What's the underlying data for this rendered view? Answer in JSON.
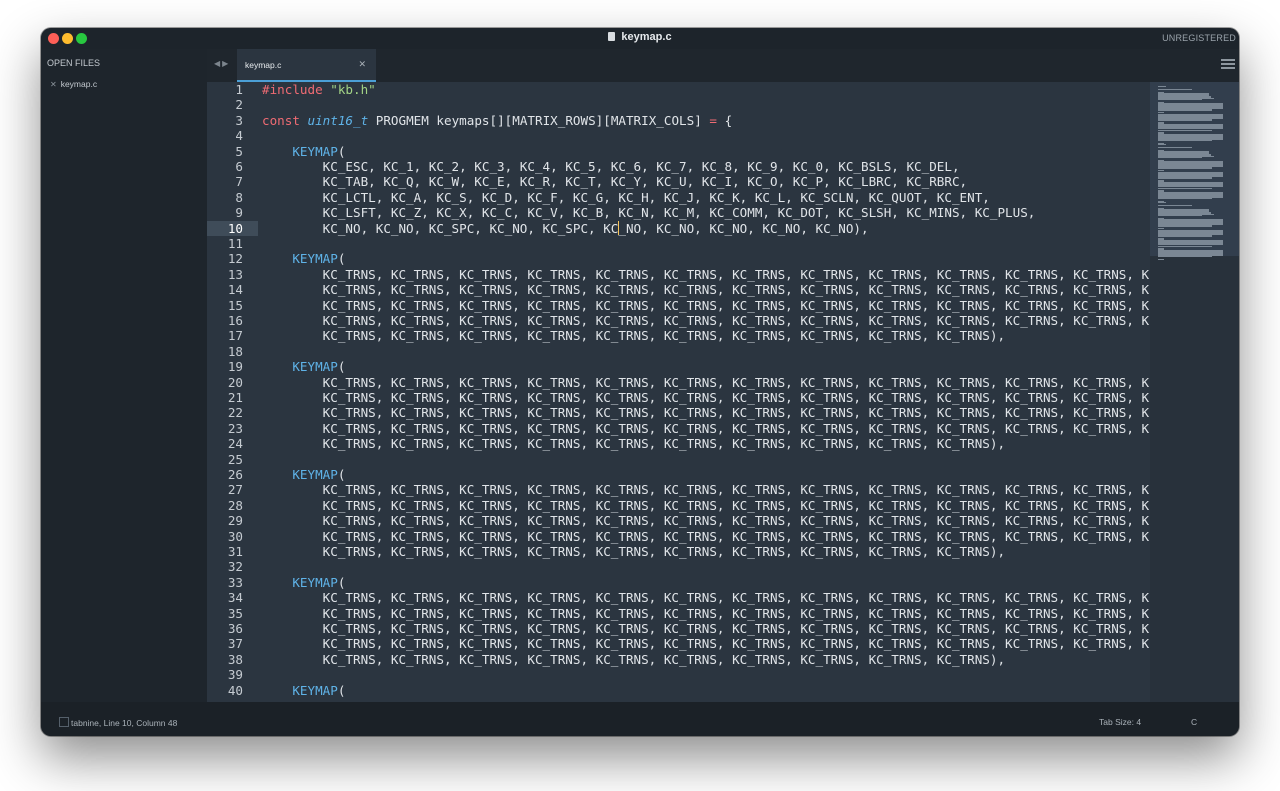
{
  "window": {
    "title": "keymap.c",
    "badge": "UNREGISTERED"
  },
  "sidebar": {
    "header": "OPEN FILES",
    "files": [
      {
        "name": "keymap.c",
        "close": "✕"
      }
    ]
  },
  "tabs": [
    {
      "label": "keymap.c",
      "close": "✕",
      "active": true
    }
  ],
  "nav": {
    "back": "◀",
    "forward": "▶"
  },
  "editor": {
    "current_line": 10,
    "lines": [
      {
        "n": "1",
        "text": "#include \"kb.h\""
      },
      {
        "n": "2",
        "text": ""
      },
      {
        "n": "3",
        "text": "const uint16_t PROGMEM keymaps[][MATRIX_ROWS][MATRIX_COLS] = {"
      },
      {
        "n": "4",
        "text": ""
      },
      {
        "n": "5",
        "text": "    KEYMAP("
      },
      {
        "n": "6",
        "text": "        KC_ESC, KC_1, KC_2, KC_3, KC_4, KC_5, KC_6, KC_7, KC_8, KC_9, KC_0, KC_BSLS, KC_DEL,"
      },
      {
        "n": "7",
        "text": "        KC_TAB, KC_Q, KC_W, KC_E, KC_R, KC_T, KC_Y, KC_U, KC_I, KC_O, KC_P, KC_LBRC, KC_RBRC,"
      },
      {
        "n": "8",
        "text": "        KC_LCTL, KC_A, KC_S, KC_D, KC_F, KC_G, KC_H, KC_J, KC_K, KC_L, KC_SCLN, KC_QUOT, KC_ENT,"
      },
      {
        "n": "9",
        "text": "        KC_LSFT, KC_Z, KC_X, KC_C, KC_V, KC_B, KC_N, KC_M, KC_COMM, KC_DOT, KC_SLSH, KC_MINS, KC_PLUS,"
      },
      {
        "n": "10",
        "text": "        KC_NO, KC_NO, KC_SPC, KC_NO, KC_SPC, KC_NO, KC_NO, KC_NO, KC_NO, KC_NO),"
      },
      {
        "n": "11",
        "text": ""
      },
      {
        "n": "12",
        "text": "    KEYMAP("
      },
      {
        "n": "13",
        "text": "        KC_TRNS, KC_TRNS, KC_TRNS, KC_TRNS, KC_TRNS, KC_TRNS, KC_TRNS, KC_TRNS, KC_TRNS, KC_TRNS, KC_TRNS, KC_TRNS, KC_"
      },
      {
        "n": "14",
        "text": "        KC_TRNS, KC_TRNS, KC_TRNS, KC_TRNS, KC_TRNS, KC_TRNS, KC_TRNS, KC_TRNS, KC_TRNS, KC_TRNS, KC_TRNS, KC_TRNS, KC_"
      },
      {
        "n": "15",
        "text": "        KC_TRNS, KC_TRNS, KC_TRNS, KC_TRNS, KC_TRNS, KC_TRNS, KC_TRNS, KC_TRNS, KC_TRNS, KC_TRNS, KC_TRNS, KC_TRNS, KC_"
      },
      {
        "n": "16",
        "text": "        KC_TRNS, KC_TRNS, KC_TRNS, KC_TRNS, KC_TRNS, KC_TRNS, KC_TRNS, KC_TRNS, KC_TRNS, KC_TRNS, KC_TRNS, KC_TRNS, KC_"
      },
      {
        "n": "17",
        "text": "        KC_TRNS, KC_TRNS, KC_TRNS, KC_TRNS, KC_TRNS, KC_TRNS, KC_TRNS, KC_TRNS, KC_TRNS, KC_TRNS),"
      },
      {
        "n": "18",
        "text": ""
      },
      {
        "n": "19",
        "text": "    KEYMAP("
      },
      {
        "n": "20",
        "text": "        KC_TRNS, KC_TRNS, KC_TRNS, KC_TRNS, KC_TRNS, KC_TRNS, KC_TRNS, KC_TRNS, KC_TRNS, KC_TRNS, KC_TRNS, KC_TRNS, KC_"
      },
      {
        "n": "21",
        "text": "        KC_TRNS, KC_TRNS, KC_TRNS, KC_TRNS, KC_TRNS, KC_TRNS, KC_TRNS, KC_TRNS, KC_TRNS, KC_TRNS, KC_TRNS, KC_TRNS, KC_"
      },
      {
        "n": "22",
        "text": "        KC_TRNS, KC_TRNS, KC_TRNS, KC_TRNS, KC_TRNS, KC_TRNS, KC_TRNS, KC_TRNS, KC_TRNS, KC_TRNS, KC_TRNS, KC_TRNS, KC_"
      },
      {
        "n": "23",
        "text": "        KC_TRNS, KC_TRNS, KC_TRNS, KC_TRNS, KC_TRNS, KC_TRNS, KC_TRNS, KC_TRNS, KC_TRNS, KC_TRNS, KC_TRNS, KC_TRNS, KC_"
      },
      {
        "n": "24",
        "text": "        KC_TRNS, KC_TRNS, KC_TRNS, KC_TRNS, KC_TRNS, KC_TRNS, KC_TRNS, KC_TRNS, KC_TRNS, KC_TRNS),"
      },
      {
        "n": "25",
        "text": ""
      },
      {
        "n": "26",
        "text": "    KEYMAP("
      },
      {
        "n": "27",
        "text": "        KC_TRNS, KC_TRNS, KC_TRNS, KC_TRNS, KC_TRNS, KC_TRNS, KC_TRNS, KC_TRNS, KC_TRNS, KC_TRNS, KC_TRNS, KC_TRNS, KC_"
      },
      {
        "n": "28",
        "text": "        KC_TRNS, KC_TRNS, KC_TRNS, KC_TRNS, KC_TRNS, KC_TRNS, KC_TRNS, KC_TRNS, KC_TRNS, KC_TRNS, KC_TRNS, KC_TRNS, KC_"
      },
      {
        "n": "29",
        "text": "        KC_TRNS, KC_TRNS, KC_TRNS, KC_TRNS, KC_TRNS, KC_TRNS, KC_TRNS, KC_TRNS, KC_TRNS, KC_TRNS, KC_TRNS, KC_TRNS, KC_"
      },
      {
        "n": "30",
        "text": "        KC_TRNS, KC_TRNS, KC_TRNS, KC_TRNS, KC_TRNS, KC_TRNS, KC_TRNS, KC_TRNS, KC_TRNS, KC_TRNS, KC_TRNS, KC_TRNS, KC_"
      },
      {
        "n": "31",
        "text": "        KC_TRNS, KC_TRNS, KC_TRNS, KC_TRNS, KC_TRNS, KC_TRNS, KC_TRNS, KC_TRNS, KC_TRNS, KC_TRNS),"
      },
      {
        "n": "32",
        "text": ""
      },
      {
        "n": "33",
        "text": "    KEYMAP("
      },
      {
        "n": "34",
        "text": "        KC_TRNS, KC_TRNS, KC_TRNS, KC_TRNS, KC_TRNS, KC_TRNS, KC_TRNS, KC_TRNS, KC_TRNS, KC_TRNS, KC_TRNS, KC_TRNS, KC_"
      },
      {
        "n": "35",
        "text": "        KC_TRNS, KC_TRNS, KC_TRNS, KC_TRNS, KC_TRNS, KC_TRNS, KC_TRNS, KC_TRNS, KC_TRNS, KC_TRNS, KC_TRNS, KC_TRNS, KC_"
      },
      {
        "n": "36",
        "text": "        KC_TRNS, KC_TRNS, KC_TRNS, KC_TRNS, KC_TRNS, KC_TRNS, KC_TRNS, KC_TRNS, KC_TRNS, KC_TRNS, KC_TRNS, KC_TRNS, KC_"
      },
      {
        "n": "37",
        "text": "        KC_TRNS, KC_TRNS, KC_TRNS, KC_TRNS, KC_TRNS, KC_TRNS, KC_TRNS, KC_TRNS, KC_TRNS, KC_TRNS, KC_TRNS, KC_TRNS, KC_"
      },
      {
        "n": "38",
        "text": "        KC_TRNS, KC_TRNS, KC_TRNS, KC_TRNS, KC_TRNS, KC_TRNS, KC_TRNS, KC_TRNS, KC_TRNS, KC_TRNS),"
      },
      {
        "n": "39",
        "text": ""
      },
      {
        "n": "40",
        "text": "    KEYMAP("
      }
    ]
  },
  "status": {
    "left": "tabnine, Line 10, Column 48",
    "tab_size": "Tab Size: 4",
    "syntax": "C"
  },
  "colors": {
    "keyword": "#ef6b73",
    "type": "#5fb3e8",
    "string": "#a3d486",
    "macro": "#5fb3e8",
    "background": "#2b3540"
  },
  "icons": {
    "menu": "hamburger-icon",
    "file": "file-icon",
    "close": "close-icon"
  }
}
